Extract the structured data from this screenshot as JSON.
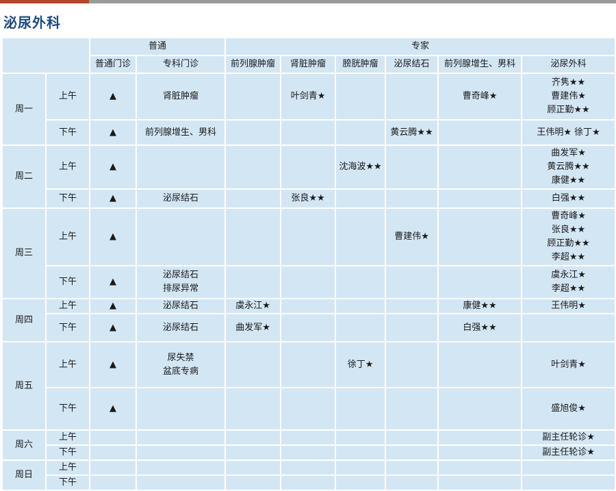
{
  "title": "泌尿外科",
  "header": {
    "groups": {
      "general": "普通",
      "expert": "专家"
    },
    "columns": [
      "普通门诊",
      "专科门诊",
      "前列腺肿瘤",
      "肾脏肿瘤",
      "膀胱肿瘤",
      "泌尿结石",
      "前列腺增生、男科",
      "泌尿外科"
    ]
  },
  "days": [
    {
      "day": "周一",
      "sessions": [
        {
          "period": "上午",
          "general": "▲",
          "specialty": [
            "肾脏肿瘤"
          ],
          "prostate_tumor": [],
          "kidney_tumor": [
            "叶剑青★"
          ],
          "bladder_tumor": [],
          "stone": [],
          "bph": [
            "曹奇峰★"
          ],
          "urology": [
            "齐隽★★",
            "曹建伟★",
            "顾正勤★★"
          ]
        },
        {
          "period": "下午",
          "general": "▲",
          "specialty": [
            "前列腺增生、男科"
          ],
          "prostate_tumor": [],
          "kidney_tumor": [],
          "bladder_tumor": [],
          "stone": [
            "黄云腾★★"
          ],
          "bph": [],
          "urology": [
            "王伟明★ 徐丁★"
          ]
        }
      ]
    },
    {
      "day": "周二",
      "sessions": [
        {
          "period": "上午",
          "general": "▲",
          "specialty": [],
          "prostate_tumor": [],
          "kidney_tumor": [],
          "bladder_tumor": [
            "沈海波★★"
          ],
          "stone": [],
          "bph": [],
          "urology": [
            "曲发军★",
            "黄云腾★★",
            "康健★★"
          ]
        },
        {
          "period": "下午",
          "general": "▲",
          "specialty": [
            "泌尿结石"
          ],
          "prostate_tumor": [],
          "kidney_tumor": [
            "张良★★"
          ],
          "bladder_tumor": [],
          "stone": [],
          "bph": [],
          "urology": [
            "白强★★"
          ]
        }
      ]
    },
    {
      "day": "周三",
      "sessions": [
        {
          "period": "上午",
          "general": "▲",
          "specialty": [],
          "prostate_tumor": [],
          "kidney_tumor": [],
          "bladder_tumor": [],
          "stone": [
            "曹建伟★"
          ],
          "bph": [],
          "urology": [
            "曹奇峰★",
            "张良★★",
            "顾正勤★★",
            "李超★★"
          ]
        },
        {
          "period": "下午",
          "general": "▲",
          "specialty": [
            "泌尿结石",
            "排尿异常"
          ],
          "prostate_tumor": [],
          "kidney_tumor": [],
          "bladder_tumor": [],
          "stone": [],
          "bph": [],
          "urology": [
            "虞永江★",
            "李超★★"
          ]
        }
      ]
    },
    {
      "day": "周四",
      "sessions": [
        {
          "period": "上午",
          "general": "▲",
          "specialty": [
            "泌尿结石"
          ],
          "prostate_tumor": [
            "虞永江★"
          ],
          "kidney_tumor": [],
          "bladder_tumor": [],
          "stone": [],
          "bph": [
            "康健★★"
          ],
          "urology": [
            "王伟明★"
          ]
        },
        {
          "period": "下午",
          "general": "▲",
          "specialty": [
            "泌尿结石"
          ],
          "prostate_tumor": [
            "曲发军★"
          ],
          "kidney_tumor": [],
          "bladder_tumor": [],
          "stone": [],
          "bph": [
            "白强★★"
          ],
          "urology": []
        }
      ]
    },
    {
      "day": "周五",
      "sessions": [
        {
          "period": "上午",
          "general": "▲",
          "specialty": [
            "尿失禁",
            "盆底专病"
          ],
          "prostate_tumor": [],
          "kidney_tumor": [],
          "bladder_tumor": [
            "徐丁★"
          ],
          "stone": [],
          "bph": [],
          "urology": [
            "叶剑青★"
          ]
        },
        {
          "period": "下午",
          "general": "▲",
          "specialty": [],
          "prostate_tumor": [],
          "kidney_tumor": [],
          "bladder_tumor": [],
          "stone": [],
          "bph": [],
          "urology": [
            "盛旭俊★"
          ]
        }
      ]
    },
    {
      "day": "周六",
      "sessions": [
        {
          "period": "上午",
          "general": "",
          "specialty": [],
          "prostate_tumor": [],
          "kidney_tumor": [],
          "bladder_tumor": [],
          "stone": [],
          "bph": [],
          "urology": [
            "副主任轮诊★"
          ]
        },
        {
          "period": "下午",
          "general": "",
          "specialty": [],
          "prostate_tumor": [],
          "kidney_tumor": [],
          "bladder_tumor": [],
          "stone": [],
          "bph": [],
          "urology": [
            "副主任轮诊★"
          ]
        }
      ]
    },
    {
      "day": "周日",
      "sessions": [
        {
          "period": "上午",
          "general": "",
          "specialty": [],
          "prostate_tumor": [],
          "kidney_tumor": [],
          "bladder_tumor": [],
          "stone": [],
          "bph": [],
          "urology": []
        },
        {
          "period": "下午",
          "general": "",
          "specialty": [],
          "prostate_tumor": [],
          "kidney_tumor": [],
          "bladder_tumor": [],
          "stone": [],
          "bph": [],
          "urology": []
        }
      ]
    }
  ]
}
